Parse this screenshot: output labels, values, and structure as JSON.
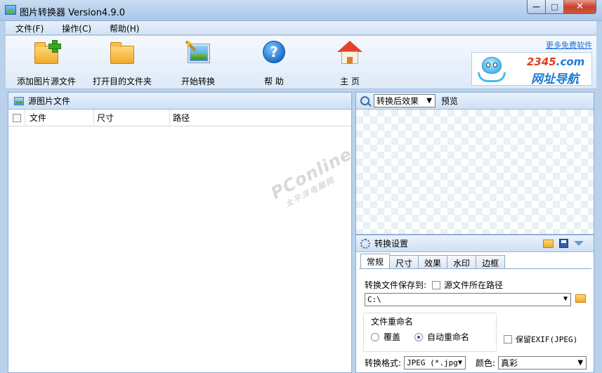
{
  "window": {
    "title": "图片转换器 Version4.9.0",
    "controls": {
      "minimize": "—",
      "maximize": "□",
      "close": "✕"
    }
  },
  "menu": [
    {
      "label": "文件(F)"
    },
    {
      "label": "操作(C)"
    },
    {
      "label": "帮助(H)"
    }
  ],
  "toolbar": {
    "add_source": "添加图片源文件",
    "open_dest": "打开目的文件夹",
    "start": "开始转换",
    "help": "帮 助",
    "home": "主 页"
  },
  "ad": {
    "link": "更多免费软件",
    "brand_num": "2345",
    "brand_tld": ".com",
    "slogan": "网址导航"
  },
  "source_panel": {
    "title": "源图片文件",
    "columns": [
      "文件",
      "尺寸",
      "路径"
    ],
    "watermark_main": "PConline",
    "watermark_sub": "太平洋电脑网"
  },
  "preview": {
    "mode": "转换后效果",
    "label": "预览"
  },
  "settings": {
    "title": "转换设置",
    "tabs": [
      "常规",
      "尺寸",
      "效果",
      "水印",
      "边框"
    ],
    "active_tab": "常规",
    "save_to_label": "转换文件保存到:",
    "source_path_label": "源文件所在路径",
    "source_path_checked": false,
    "output_path": "C:\\",
    "rename_group": "文件重命名",
    "rename_overwrite": "覆盖",
    "rename_auto": "自动重命名",
    "rename_selected": "自动重命名",
    "keep_exif": "保留EXIF(JPEG)",
    "keep_exif_checked": false,
    "format_label": "转换格式:",
    "format_value": "JPEG (*.jpg",
    "color_label": "颜色:",
    "color_value": "真彩"
  }
}
